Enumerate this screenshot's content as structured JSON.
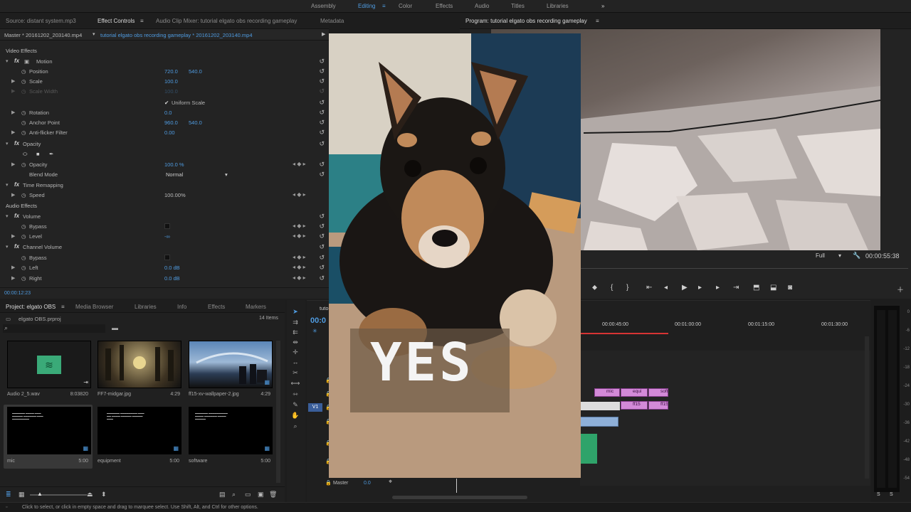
{
  "workspaces": [
    "Assembly",
    "Editing",
    "Color",
    "Effects",
    "Audio",
    "Titles",
    "Libraries"
  ],
  "active_workspace": "Editing",
  "more_icon": "double-chevron-right",
  "source_tabs": {
    "source": "Source: distant system.mp3",
    "effect_controls": "Effect Controls",
    "audio_mixer": "Audio Clip Mixer: tutorial elgato obs recording gameplay",
    "metadata": "Metadata"
  },
  "ec": {
    "master": "Master * 20161202_203140.mp4",
    "sequence": "tutorial elgato obs recording gameplay * 20161202_203140.mp4",
    "video_effects": "Video Effects",
    "motion": "Motion",
    "position_label": "Position",
    "position_x": "720.0",
    "position_y": "540.0",
    "scale_label": "Scale",
    "scale_val": "100.0",
    "scale_width_label": "Scale Width",
    "scale_width_val": "100.0",
    "uniform_scale": "Uniform Scale",
    "rotation_label": "Rotation",
    "rotation_val": "0.0",
    "anchor_label": "Anchor Point",
    "anchor_x": "960.0",
    "anchor_y": "540.0",
    "flicker_label": "Anti-flicker Filter",
    "flicker_val": "0.00",
    "opacity_section": "Opacity",
    "opacity_label": "Opacity",
    "opacity_val": "100.0 %",
    "blend_label": "Blend Mode",
    "blend_val": "Normal",
    "time_remap": "Time Remapping",
    "speed_label": "Speed",
    "speed_val": "100.00%",
    "audio_effects": "Audio Effects",
    "volume": "Volume",
    "bypass_label": "Bypass",
    "level_label": "Level",
    "level_val": "-∞",
    "channel_volume": "Channel Volume",
    "bypass2_label": "Bypass",
    "left_label": "Left",
    "left_val": "0.0 dB",
    "right_label": "Right",
    "right_val": "0.0 dB",
    "timecode": "00:00:12:23"
  },
  "project": {
    "tabs": [
      "Project: elgato OBS",
      "Media Browser",
      "Libraries",
      "Info",
      "Effects",
      "Markers"
    ],
    "file": "elgato OBS.prproj",
    "count": "14 Items",
    "items": [
      {
        "name": "Audio 2_5.wav",
        "dur": "8:03820"
      },
      {
        "name": "FF7-midgar.jpg",
        "dur": "4:29"
      },
      {
        "name": "ff15-xv-wallpaper-2.jpg",
        "dur": "4:29"
      },
      {
        "name": "mic",
        "dur": "5:00"
      },
      {
        "name": "equipment",
        "dur": "5:00"
      },
      {
        "name": "software",
        "dur": "5:00"
      }
    ]
  },
  "program": {
    "title": "Program: tutorial elgato obs recording gameplay",
    "zoom": "Full",
    "timecode": "00:00:55:38"
  },
  "overlay_text": "YES",
  "timeline": {
    "tab": "tutori",
    "timecode": "00:0",
    "ruler": [
      "00:00:45:00",
      "00:01:00:00",
      "00:01:15:00",
      "00:01:30:00"
    ],
    "track_v1": "V1",
    "master": "Master",
    "master_val": "0.0",
    "clips_row1": [
      "mic",
      "equi",
      "soft"
    ],
    "clips_row2": [
      "ff15",
      "ff15"
    ]
  },
  "vu": {
    "labels": [
      "0",
      "-6",
      "-12",
      "-18",
      "-24",
      "-30",
      "-36",
      "-42",
      "-48",
      "-54"
    ],
    "solo": [
      "S",
      "S"
    ]
  },
  "status": "Click to select, or click in empty space and drag to marquee select. Use Shift, Alt, and Ctrl for other options."
}
